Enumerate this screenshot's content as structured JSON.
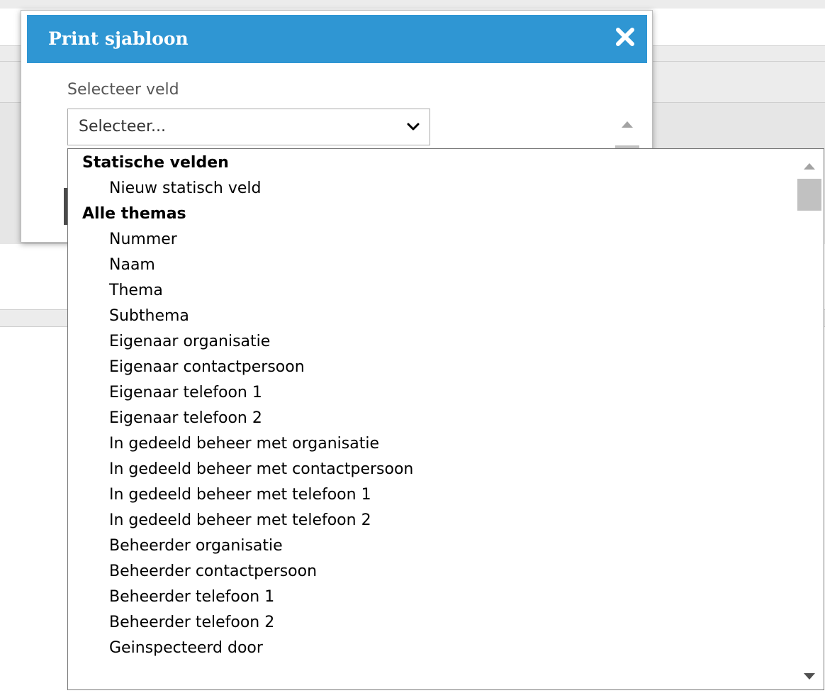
{
  "dialog": {
    "title": "Print sjabloon",
    "close_icon": "close-icon",
    "field_label": "Selecteer veld",
    "select": {
      "value": "Selecteer...",
      "chevron_icon": "chevron-down-icon"
    }
  },
  "dropdown": {
    "groups": [
      {
        "label": "Statische velden",
        "options": [
          "Nieuw statisch veld"
        ]
      },
      {
        "label": "Alle themas",
        "options": [
          "Nummer",
          "Naam",
          "Thema",
          "Subthema",
          "Eigenaar organisatie",
          "Eigenaar contactpersoon",
          "Eigenaar telefoon 1",
          "Eigenaar telefoon 2",
          "In gedeeld beheer met organisatie",
          "In gedeeld beheer met contactpersoon",
          "In gedeeld beheer met telefoon 1",
          "In gedeeld beheer met telefoon 2",
          "Beheerder organisatie",
          "Beheerder contactpersoon",
          "Beheerder telefoon 1",
          "Beheerder telefoon 2",
          "Geinspecteerd door"
        ]
      }
    ]
  },
  "colors": {
    "header_bg": "#2f96d3",
    "header_text": "#ffffff",
    "scrollbar_thumb": "#c1c1c1"
  }
}
